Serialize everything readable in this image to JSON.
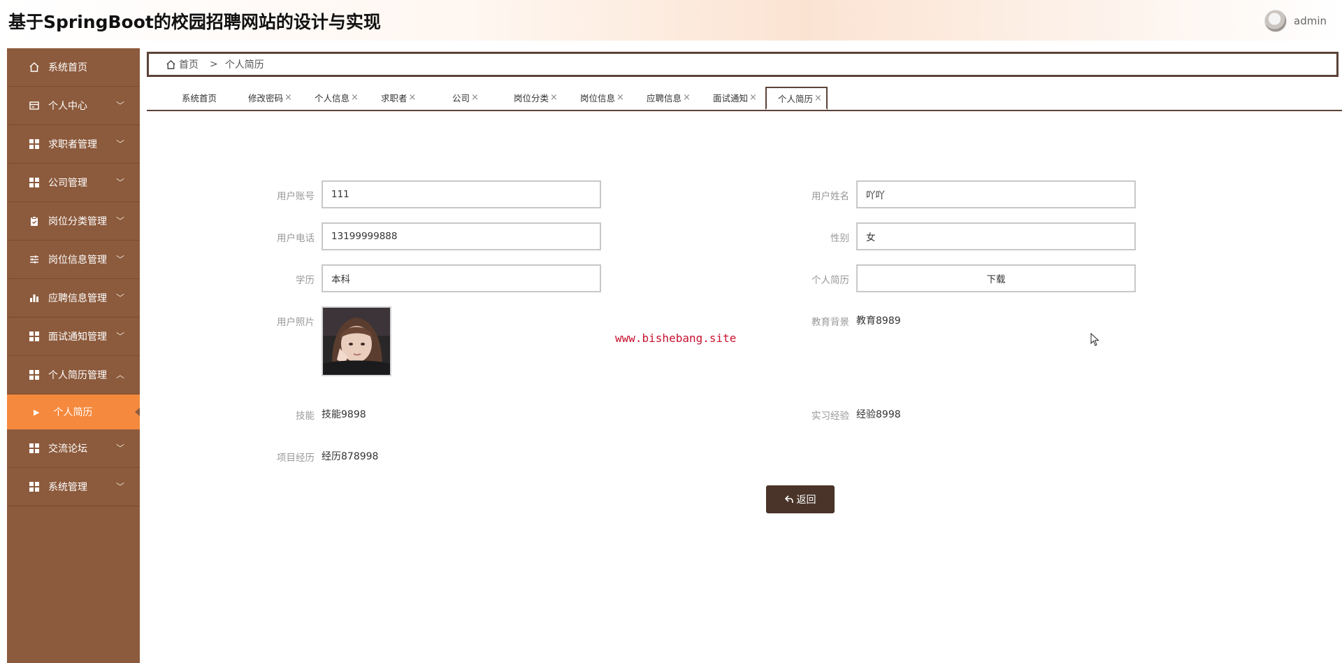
{
  "header": {
    "title": "基于SpringBoot的校园招聘网站的设计与实现",
    "username": "admin"
  },
  "sidebar": {
    "items": [
      {
        "label": "系统首页",
        "icon": "home-icon"
      },
      {
        "label": "个人中心",
        "icon": "card-icon"
      },
      {
        "label": "求职者管理",
        "icon": "grid-icon"
      },
      {
        "label": "公司管理",
        "icon": "grid-icon"
      },
      {
        "label": "岗位分类管理",
        "icon": "clipboard-icon"
      },
      {
        "label": "岗位信息管理",
        "icon": "sliders-icon"
      },
      {
        "label": "应聘信息管理",
        "icon": "bar-chart-icon"
      },
      {
        "label": "面试通知管理",
        "icon": "grid-icon"
      },
      {
        "label": "个人简历管理",
        "icon": "grid-icon"
      },
      {
        "label": "交流论坛",
        "icon": "grid-icon"
      },
      {
        "label": "系统管理",
        "icon": "grid-icon"
      }
    ],
    "sub_item": "个人简历"
  },
  "breadcrumb": {
    "home": "首页",
    "separator": ">",
    "current": "个人简历"
  },
  "tabs": [
    {
      "label": "系统首页",
      "closable": false
    },
    {
      "label": "修改密码",
      "closable": true
    },
    {
      "label": "个人信息",
      "closable": true
    },
    {
      "label": "求职者",
      "closable": true
    },
    {
      "label": "公司",
      "closable": true
    },
    {
      "label": "岗位分类",
      "closable": true
    },
    {
      "label": "岗位信息",
      "closable": true
    },
    {
      "label": "应聘信息",
      "closable": true
    },
    {
      "label": "面试通知",
      "closable": true
    },
    {
      "label": "个人简历",
      "closable": true,
      "active": true
    }
  ],
  "tab_close": "×",
  "form": {
    "account_label": "用户账号",
    "account_value": "111",
    "name_label": "用户姓名",
    "name_value": "吖吖",
    "phone_label": "用户电话",
    "phone_value": "13199999888",
    "gender_label": "性别",
    "gender_value": "女",
    "education_label": "学历",
    "education_value": "本科",
    "resume_label": "个人简历",
    "resume_button": "下载",
    "photo_label": "用户照片",
    "edu_background_label": "教育背景",
    "edu_background_value": "教育8989",
    "skills_label": "技能",
    "skills_value": "技能9898",
    "internship_label": "实习经验",
    "internship_value": "经验8998",
    "project_label": "项目经历",
    "project_value": "经历878998",
    "back_button": "返回"
  },
  "watermark": "www.bishebang.site",
  "colors": {
    "sidebar_bg": "#8c5a3c",
    "active_sub_bg": "#f5893d",
    "dark_brown": "#5b4338",
    "back_button_bg": "#4a3429",
    "watermark": "#c8102e"
  }
}
